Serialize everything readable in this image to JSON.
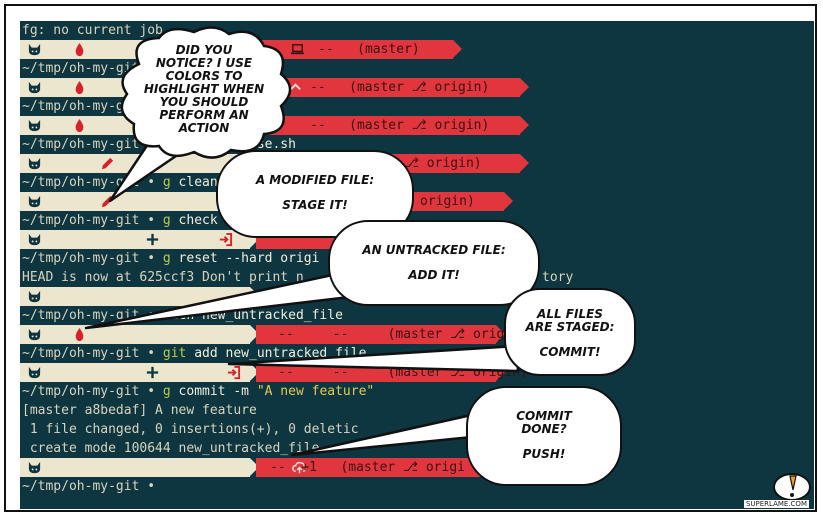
{
  "terminal": {
    "lines": [
      {
        "path": "fg: no current job"
      },
      {
        "path": "~/tmp/oh-my-git"
      },
      {
        "path": "~/tmp/oh-my-git"
      },
      {
        "path": "~/tmp/oh-my-git",
        "tail": "ase.sh"
      },
      {
        "path": "~/tmp/oh-my-git",
        "dot": "•",
        "git": "g",
        "cmd": "clean"
      },
      {
        "path": "~/tmp/oh-my-git",
        "dot": "•",
        "git": "g",
        "cmd": "check"
      },
      {
        "path": "~/tmp/oh-my-git",
        "dot": "•",
        "git": "g",
        "cmd": "reset --hard origi"
      },
      {
        "path": "HEAD is now at 625ccf3 Don't print n",
        "tail": "tory"
      },
      {
        "path": "~/tmp/oh-my-git",
        "dot": "•",
        "cmd": "ouch new_untracked_file"
      },
      {
        "path": "~/tmp/oh-my-git",
        "dot": "•",
        "git": "git",
        "cmd": "add new_untracked_file"
      },
      {
        "path": "~/tmp/oh-my-git",
        "dot": "•",
        "git": "g",
        "cmd": "commit -m",
        "str": "\"A new feature\""
      },
      {
        "path": "[master a8bedaf] A new feature"
      },
      {
        "path": " 1 file changed, 0 insertions(+), 0 deletic"
      },
      {
        "path": " create mode 100644 new_untracked_file"
      },
      {
        "path": "~/tmp/oh-my-git",
        "dot": "•"
      }
    ],
    "bars": [
      {
        "info": "--   (master)"
      },
      {
        "info": "--   (master ⎇ origin)"
      },
      {
        "info": "--   (master ⎇ origin)"
      },
      {
        "info": "⎇ origin)"
      },
      {
        "info": "origin)"
      },
      {
        "info": ""
      },
      {
        "info": ""
      },
      {
        "info": "--     --     (master ⎇ origin)"
      },
      {
        "info": "--     --     (master ⎇ origin)"
      },
      {
        "info": "--  +1   (master ⎇ origi"
      }
    ]
  },
  "bubbles": {
    "notice": [
      "DID YOU",
      "NOTICE? I USE",
      "COLORS TO",
      "HIGHLIGHT WHEN",
      "YOU SHOULD",
      "PERFORM AN",
      "ACTION"
    ],
    "modified": [
      "A MODIFIED FILE:",
      "STAGE IT!"
    ],
    "untracked": [
      "AN UNTRACKED FILE:",
      "ADD IT!"
    ],
    "staged": [
      "ALL FILES",
      "ARE STAGED:",
      "COMMIT!"
    ],
    "done": [
      "COMMIT",
      "DONE?",
      "PUSH!"
    ]
  },
  "watermark": "SUPERLAME.COM",
  "colors": {
    "terminal_bg": "#0d3640",
    "bar_light": "#ede6cf",
    "bar_red": "#e2363f",
    "accent_red": "#d8202a"
  }
}
